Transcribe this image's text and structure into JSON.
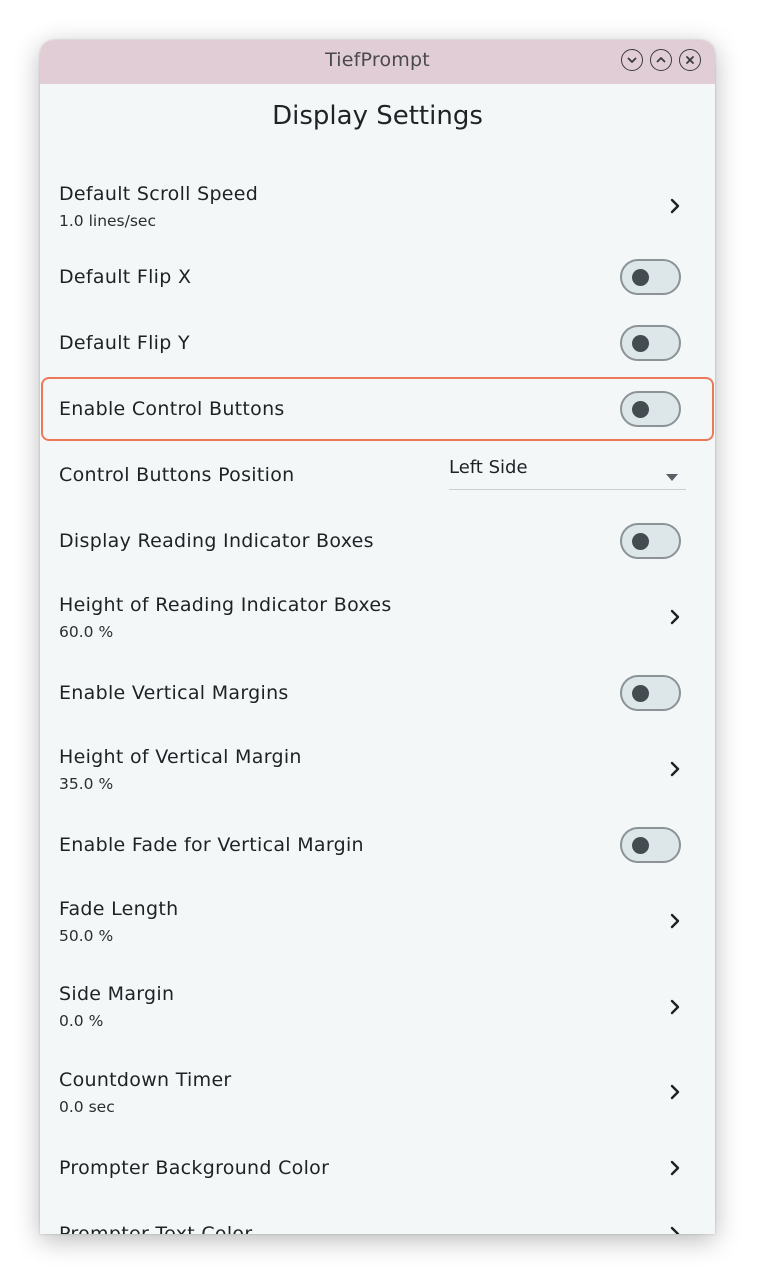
{
  "window": {
    "title": "TiefPrompt"
  },
  "titlebar_buttons": [
    "minimize-icon",
    "maximize-icon",
    "close-icon"
  ],
  "page": {
    "title": "Display Settings"
  },
  "settings": [
    {
      "label": "Default Scroll Speed",
      "value": "1.0 lines/sec",
      "control": "chevron"
    },
    {
      "label": "Default Flip X",
      "control": "toggle",
      "on": false
    },
    {
      "label": "Default Flip Y",
      "control": "toggle",
      "on": false
    },
    {
      "label": "Enable Control Buttons",
      "control": "toggle",
      "on": false,
      "highlighted": true
    },
    {
      "label": "Control Buttons Position",
      "control": "select",
      "selected": "Left Side"
    },
    {
      "label": "Display Reading Indicator Boxes",
      "control": "toggle",
      "on": false
    },
    {
      "label": "Height of Reading Indicator Boxes",
      "value": "60.0 %",
      "control": "chevron"
    },
    {
      "label": "Enable Vertical Margins",
      "control": "toggle",
      "on": false
    },
    {
      "label": "Height of Vertical Margin",
      "value": "35.0 %",
      "control": "chevron"
    },
    {
      "label": "Enable Fade for Vertical Margin",
      "control": "toggle",
      "on": false
    },
    {
      "label": "Fade Length",
      "value": "50.0 %",
      "control": "chevron"
    },
    {
      "label": "Side Margin",
      "value": "0.0 %",
      "control": "chevron"
    },
    {
      "label": "Countdown Timer",
      "value": "0.0 sec",
      "control": "chevron"
    },
    {
      "label": "Prompter Background Color",
      "control": "chevron"
    },
    {
      "label": "Prompter Text Color",
      "control": "chevron"
    }
  ],
  "colors": {
    "titlebar": "#e1cdd6",
    "background": "#f4f7f8",
    "highlight": "#ec7a5a",
    "toggle_track": "#dde6e9",
    "toggle_knob": "#444c52"
  }
}
